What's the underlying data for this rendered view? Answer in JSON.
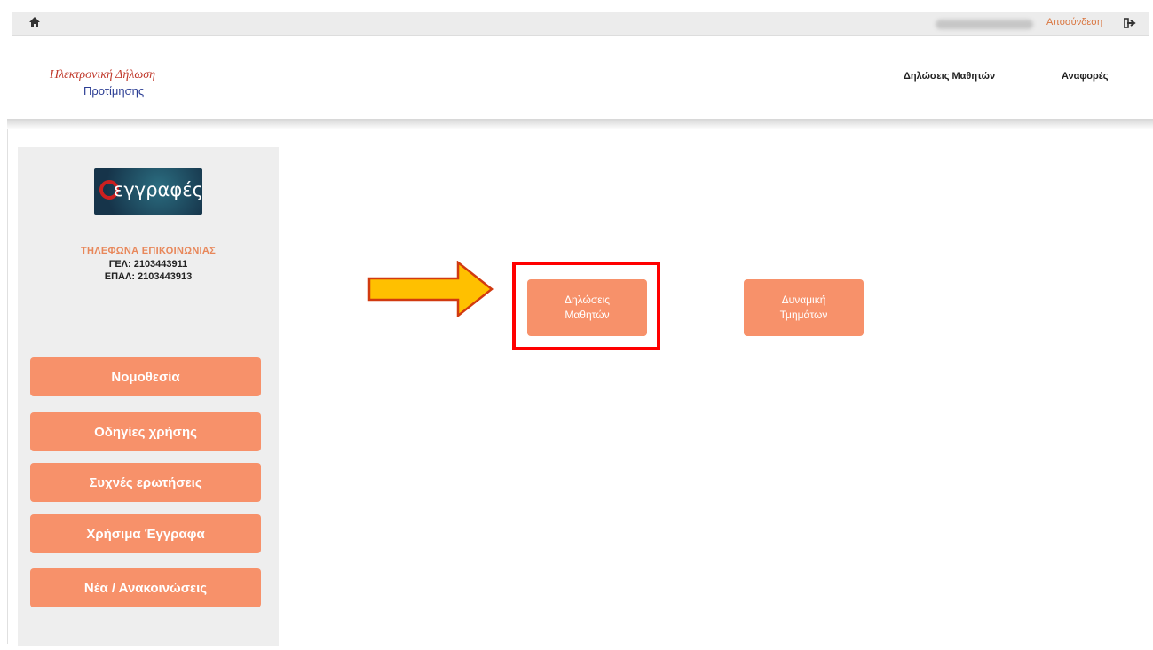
{
  "topbar": {
    "home_icon": "home-icon",
    "logout_label": "Αποσύνδεση",
    "logout_icon": "sign-out-icon"
  },
  "header": {
    "brand_line1": "Ηλεκτρονική Δήλωση",
    "brand_line2": "Προτίμησης",
    "nav": [
      {
        "label": "Δηλώσεις Μαθητών"
      },
      {
        "label": "Αναφορές"
      }
    ]
  },
  "sidebar": {
    "logo_text": "εγγραφές",
    "contact_title": "ΤΗΛΕΦΩΝΑ ΕΠΙΚΟΙΝΩΝΙΑΣ",
    "phone_gel": "ΓΕΛ: 2103443911",
    "phone_epal": "ΕΠΑΛ: 2103443913",
    "buttons": [
      {
        "label": "Νομοθεσία"
      },
      {
        "label": "Οδηγίες χρήσης"
      },
      {
        "label": "Συχνές ερωτήσεις"
      },
      {
        "label": "Χρήσιμα Έγγραφα"
      },
      {
        "label": "Νέα / Ανακοινώσεις"
      }
    ]
  },
  "main": {
    "buttons": [
      {
        "line1": "Δηλώσεις",
        "line2": "Μαθητών"
      },
      {
        "line1": "Δυναμική",
        "line2": "Τμημάτων"
      }
    ]
  },
  "colors": {
    "accent_orange": "#f7916a",
    "highlight_red": "#ff0000",
    "arrow_fill": "#ffc000",
    "arrow_stroke": "#d13a10"
  }
}
